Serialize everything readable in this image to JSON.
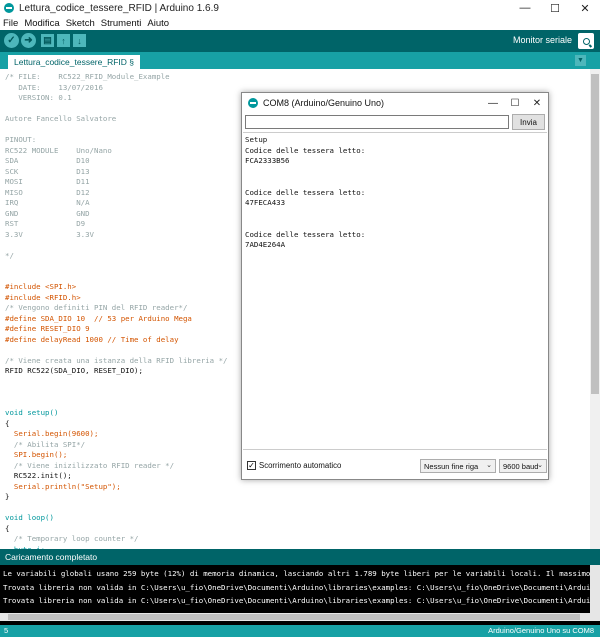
{
  "window": {
    "title": "Lettura_codice_tessere_RFID | Arduino 1.6.9",
    "controls": {
      "minimize": "—",
      "maximize": "☐",
      "close": "✕"
    }
  },
  "menu": {
    "items": [
      "File",
      "Modifica",
      "Sketch",
      "Strumenti",
      "Aiuto"
    ]
  },
  "toolbar": {
    "verify_icon": "check-icon",
    "upload_icon": "right-arrow-icon",
    "new_icon": "new-file-icon",
    "open_icon": "up-arrow-icon",
    "save_icon": "down-arrow-icon",
    "monitor_label": "Monitor seriale"
  },
  "tab": {
    "label": "Lettura_codice_tessere_RFID §"
  },
  "code_lines": [
    {
      "type": "comment",
      "text": "/* FILE:    RC522_RFID_Module_Example"
    },
    {
      "type": "comment",
      "text": "   DATE:    13/07/2016"
    },
    {
      "type": "comment",
      "text": "   VERSION: 0.1"
    },
    {
      "type": "comment",
      "text": ""
    },
    {
      "type": "comment",
      "text": "Autore Fancello Salvatore"
    },
    {
      "type": "comment",
      "text": ""
    },
    {
      "type": "comment",
      "text": "PINOUT:"
    },
    {
      "type": "comment",
      "text": "RC522 MODULE    Uno/Nano"
    },
    {
      "type": "comment",
      "text": "SDA             D10"
    },
    {
      "type": "comment",
      "text": "SCK             D13"
    },
    {
      "type": "comment",
      "text": "MOSI            D11"
    },
    {
      "type": "comment",
      "text": "MISO            D12"
    },
    {
      "type": "comment",
      "text": "IRQ             N/A"
    },
    {
      "type": "comment",
      "text": "GND             GND"
    },
    {
      "type": "comment",
      "text": "RST             D9"
    },
    {
      "type": "comment",
      "text": "3.3V            3.3V"
    },
    {
      "type": "comment",
      "text": ""
    },
    {
      "type": "comment",
      "text": "*/"
    },
    {
      "type": "text",
      "text": ""
    },
    {
      "type": "text",
      "text": ""
    },
    {
      "type": "kw",
      "text": "#include <SPI.h>"
    },
    {
      "type": "kw",
      "text": "#include <RFID.h>"
    },
    {
      "type": "comment",
      "text": "/* Vengono definiti PIN del RFID reader*/"
    },
    {
      "type": "kw",
      "text": "#define SDA_DIO 10  // 53 per Arduino Mega"
    },
    {
      "type": "kw",
      "text": "#define RESET_DIO 9"
    },
    {
      "type": "kw",
      "text": "#define delayRead 1000 // Time of delay"
    },
    {
      "type": "text",
      "text": ""
    },
    {
      "type": "comment",
      "text": "/* Viene creata una istanza della RFID libreria */"
    },
    {
      "type": "text",
      "text": "RFID RC522(SDA_DIO, RESET_DIO);"
    },
    {
      "type": "text",
      "text": ""
    },
    {
      "type": "text",
      "text": ""
    },
    {
      "type": "text",
      "text": ""
    },
    {
      "type": "type",
      "text": "void setup()"
    },
    {
      "type": "text",
      "text": "{"
    },
    {
      "type": "kw",
      "text": "  Serial.begin(9600);"
    },
    {
      "type": "comment",
      "text": "  /* Abilita SPI*/"
    },
    {
      "type": "kw",
      "text": "  SPI.begin();"
    },
    {
      "type": "comment",
      "text": "  /* Viene inizilizzato RFID reader */"
    },
    {
      "type": "text",
      "text": "  RC522.init();"
    },
    {
      "type": "kw",
      "text": "  Serial.println(\"Setup\");"
    },
    {
      "type": "text",
      "text": "}"
    },
    {
      "type": "text",
      "text": ""
    },
    {
      "type": "type",
      "text": "void loop()"
    },
    {
      "type": "text",
      "text": "{"
    },
    {
      "type": "comment",
      "text": "  /* Temporary loop counter */"
    },
    {
      "type": "type",
      "text": "  byte i;"
    }
  ],
  "status": {
    "message": "Caricamento completato"
  },
  "console_lines": [
    "Le variabili globali usano 259 byte (12%) di memoria dinamica, lasciando altri 1.789 byte liberi per le variabili locali. Il massimo è 2.",
    "Trovata libreria non valida in C:\\Users\\u_fio\\OneDrive\\Documenti\\Arduino\\libraries\\examples: C:\\Users\\u_fio\\OneDrive\\Documenti\\Arduino\\li",
    "Trovata libreria non valida in C:\\Users\\u_fio\\OneDrive\\Documenti\\Arduino\\libraries\\examples: C:\\Users\\u_fio\\OneDrive\\Documenti\\Arduino\\li"
  ],
  "bottom": {
    "line_number": "5",
    "board": "Arduino/Genuino Uno su COM8"
  },
  "serial": {
    "title": "COM8 (Arduino/Genuino Uno)",
    "input_value": "",
    "send_label": "Invia",
    "output": [
      "Setup",
      "Codice delle tessera letto:",
      "FCA2333B56",
      "",
      "",
      "Codice delle tessera letto:",
      "47FECA433",
      "",
      "",
      "Codice delle tessera letto:",
      "7AD4E264A"
    ],
    "autoscroll_label": "Scorrimento automatico",
    "autoscroll_checked": "✓",
    "line_ending": "Nessun fine riga",
    "baud": "9600 baud"
  }
}
